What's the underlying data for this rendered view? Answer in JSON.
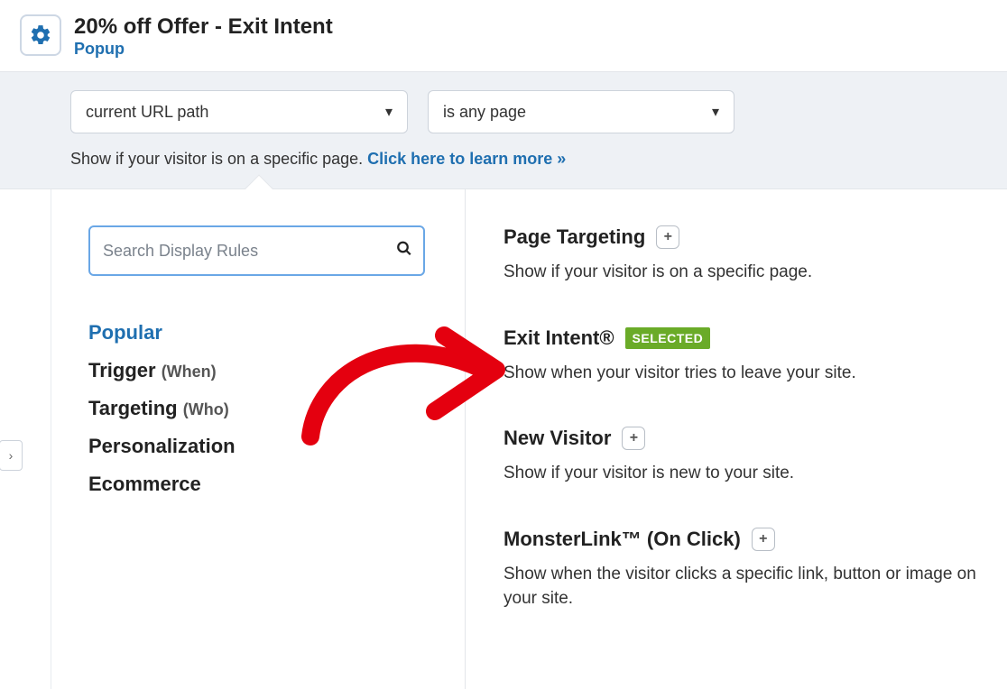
{
  "header": {
    "title": "20% off Offer - Exit Intent",
    "subtitle": "Popup"
  },
  "filter": {
    "select1": "current URL path",
    "select2": "is any page",
    "desc": "Show if your visitor is on a specific page. ",
    "link": "Click here to learn more »"
  },
  "search": {
    "placeholder": "Search Display Rules"
  },
  "categories": [
    {
      "label": "Popular",
      "active": true
    },
    {
      "label": "Trigger",
      "note": "(When)"
    },
    {
      "label": "Targeting",
      "note": "(Who)"
    },
    {
      "label": "Personalization"
    },
    {
      "label": "Ecommerce"
    }
  ],
  "rules": [
    {
      "title": "Page Targeting",
      "action": "plus",
      "desc": "Show if your visitor is on a specific page."
    },
    {
      "title": "Exit Intent®",
      "badge": "SELECTED",
      "desc": "Show when your visitor tries to leave your site."
    },
    {
      "title": "New Visitor",
      "action": "plus",
      "desc": "Show if your visitor is new to your site."
    },
    {
      "title": "MonsterLink™ (On Click)",
      "action": "plus",
      "desc": "Show when the visitor clicks a specific link, button or image on your site."
    }
  ]
}
